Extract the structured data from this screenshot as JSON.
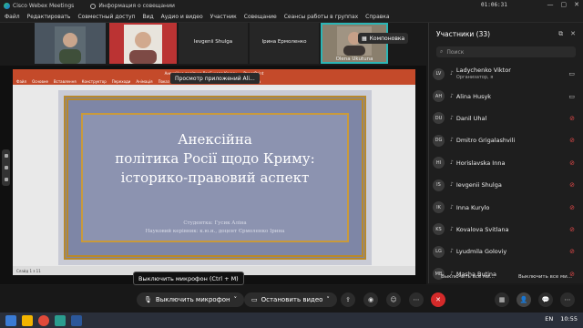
{
  "window": {
    "app_title": "Cisco Webex Meetings",
    "info_label": "Информация о совещании",
    "timer": "01:06:31",
    "win_controls": [
      "—",
      "▢",
      "✕"
    ]
  },
  "menu": [
    "Файл",
    "Редактировать",
    "Совместный доступ",
    "Вид",
    "Аудио и видео",
    "Участник",
    "Совещание",
    "Сеансы работы в группах",
    "Справка"
  ],
  "thumbnails": [
    {
      "name": "",
      "kind": "video"
    },
    {
      "name": "",
      "kind": "video"
    },
    {
      "name": "Ievgenii Shulga",
      "kind": "name"
    },
    {
      "name": "Ірина Ермоленко",
      "kind": "name"
    },
    {
      "name": "Olena Ukutuna",
      "kind": "video"
    }
  ],
  "layout_button": "Компоновка",
  "view_tooltip": "Просмотр приложений Ali...",
  "slide": {
    "ppt_window_title": "Анексійна політика Росії щодо Криму... - PowerPoint",
    "ppt_tabs": [
      "Файл",
      "Основне",
      "Вставлення",
      "Конструктор",
      "Переходи",
      "Анімація",
      "Показ слайдів",
      "Рецензування",
      "Подання",
      "Довідка"
    ],
    "title_lines": [
      "Анексійна",
      "політика Росії щодо Криму:",
      "історико-правовий аспект"
    ],
    "author_line": "Студентка: Гусик Аліна",
    "advisor_line": "Науковий керівник: к.ю.н., доцент Єрмоленко Ірина",
    "status_text": "Слайд 1 з 11"
  },
  "participants": {
    "header": "Участники (33)",
    "search_placeholder": "Поиск",
    "list": [
      {
        "initials": "LV",
        "name": "Ladychenko Viktor",
        "sub": "Организатор, я",
        "status": "cam"
      },
      {
        "initials": "AH",
        "name": "Alina Husyk",
        "sub": "",
        "status": "cam"
      },
      {
        "initials": "DU",
        "name": "Danil Uhal",
        "sub": "",
        "status": "mute"
      },
      {
        "initials": "DG",
        "name": "Dmitro Grigalashvili",
        "sub": "",
        "status": "mute"
      },
      {
        "initials": "HI",
        "name": "Horislavska Inna",
        "sub": "",
        "status": "mute"
      },
      {
        "initials": "IS",
        "name": "Ievgenii Shulga",
        "sub": "",
        "status": "mute"
      },
      {
        "initials": "IK",
        "name": "Inna Kurylo",
        "sub": "",
        "status": "mute"
      },
      {
        "initials": "KS",
        "name": "Kovalova Svitlana",
        "sub": "",
        "status": "mute"
      },
      {
        "initials": "LG",
        "name": "Lyudmila Goloviy",
        "sub": "",
        "status": "mute"
      },
      {
        "initials": "MB",
        "name": "Masha Butina",
        "sub": "",
        "status": "mute"
      }
    ],
    "mute_all": "Выключить все ми...",
    "unmute_all": "Выключить все ми..."
  },
  "mic_tooltip": "Выключить микрофон (Ctrl + M)",
  "controls": {
    "mic": "Выключить микрофон",
    "video": "Остановить видео"
  },
  "taskbar": {
    "lang": "EN",
    "clock": "10:55"
  },
  "colors": {
    "accent": "#2bb5b5",
    "leave": "#d42a2a",
    "ppt_red": "#c44a2a"
  }
}
